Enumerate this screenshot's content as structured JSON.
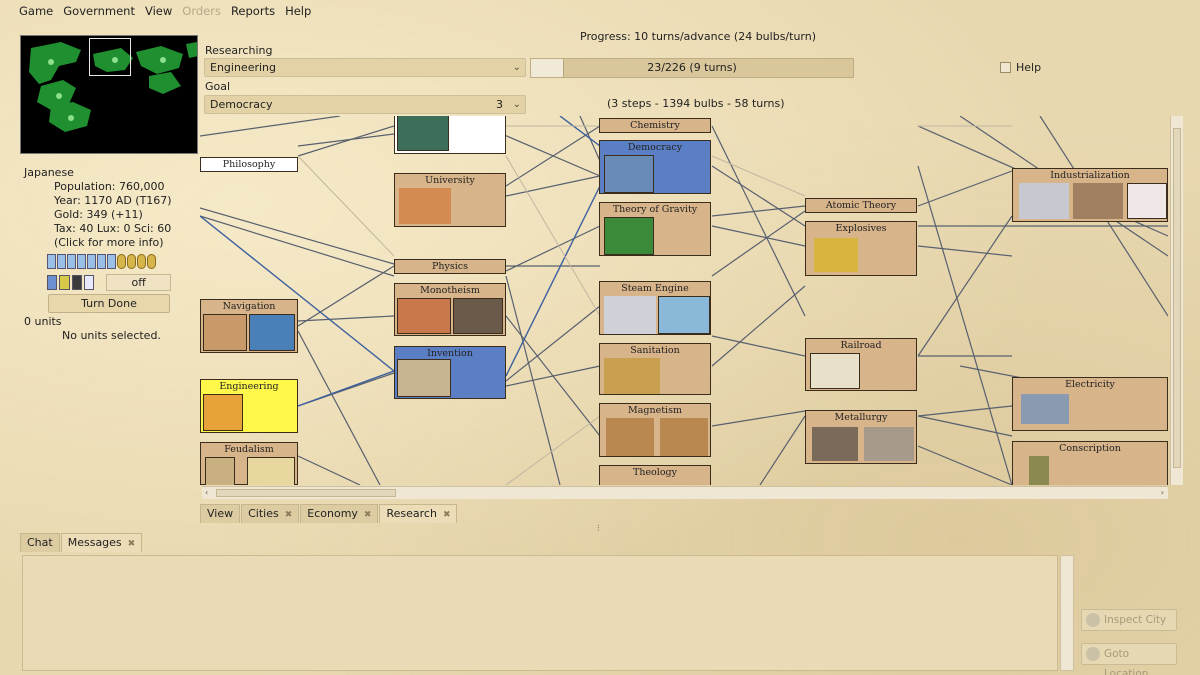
{
  "menubar": {
    "items": [
      {
        "label": "Game",
        "enabled": true
      },
      {
        "label": "Government",
        "enabled": true
      },
      {
        "label": "View",
        "enabled": true
      },
      {
        "label": "Orders",
        "enabled": false
      },
      {
        "label": "Reports",
        "enabled": true
      },
      {
        "label": "Help",
        "enabled": true
      }
    ]
  },
  "info": {
    "nation": "Japanese",
    "population": "Population: 760,000",
    "year": "Year: 1170 AD (T167)",
    "gold": "Gold: 349 (+11)",
    "rates": "Tax: 40 Lux: 0 Sci: 60",
    "hint": "(Click for more info)"
  },
  "status": {
    "off_label": "off",
    "turn_done": "Turn Done",
    "units_count": "0 units",
    "units_selected": "No units selected."
  },
  "research": {
    "progress": "Progress: 10 turns/advance (24 bulbs/turn)",
    "researching_label": "Researching",
    "researching_value": "Engineering",
    "bar_text": "23/226 (9 turns)",
    "bar_fraction": 0.102,
    "help_label": "Help",
    "goal_label": "Goal",
    "goal_value": "Democracy",
    "goal_steps_count": "3",
    "goal_summary": "(3 steps - 1394 bulbs - 58 turns)"
  },
  "tree": {
    "nodes": [
      {
        "key": "philosophy",
        "label": "Philosophy"
      },
      {
        "key": "university",
        "label": "University"
      },
      {
        "key": "physics",
        "label": "Physics"
      },
      {
        "key": "monotheism",
        "label": "Monotheism"
      },
      {
        "key": "invention",
        "label": "Invention"
      },
      {
        "key": "navigation",
        "label": "Navigation"
      },
      {
        "key": "engineering",
        "label": "Engineering"
      },
      {
        "key": "feudalism",
        "label": "Feudalism"
      },
      {
        "key": "chemistry",
        "label": "Chemistry"
      },
      {
        "key": "democracy",
        "label": "Democracy"
      },
      {
        "key": "theory-of-gravity",
        "label": "Theory of Gravity"
      },
      {
        "key": "steam-engine",
        "label": "Steam Engine"
      },
      {
        "key": "sanitation",
        "label": "Sanitation"
      },
      {
        "key": "magnetism",
        "label": "Magnetism"
      },
      {
        "key": "theology",
        "label": "Theology"
      },
      {
        "key": "atomic-theory",
        "label": "Atomic Theory"
      },
      {
        "key": "explosives",
        "label": "Explosives"
      },
      {
        "key": "railroad",
        "label": "Railroad"
      },
      {
        "key": "metallurgy",
        "label": "Metallurgy"
      },
      {
        "key": "industrialization",
        "label": "Industrialization"
      },
      {
        "key": "electricity",
        "label": "Electricity"
      },
      {
        "key": "conscription",
        "label": "Conscription"
      }
    ]
  },
  "bottom_tabs": [
    {
      "label": "View",
      "closable": false
    },
    {
      "label": "Cities",
      "closable": true
    },
    {
      "label": "Economy",
      "closable": true
    },
    {
      "label": "Research",
      "closable": true
    }
  ],
  "chat_tabs": [
    {
      "label": "Chat",
      "closable": false
    },
    {
      "label": "Messages",
      "closable": true
    }
  ],
  "buttons": {
    "inspect_city": "Inspect City",
    "goto_location": "Goto Location"
  },
  "colors": {
    "goal": "#5a7fc4",
    "current": "#fff84a",
    "known": "#d8b48a",
    "background": "#e8d8b0"
  }
}
